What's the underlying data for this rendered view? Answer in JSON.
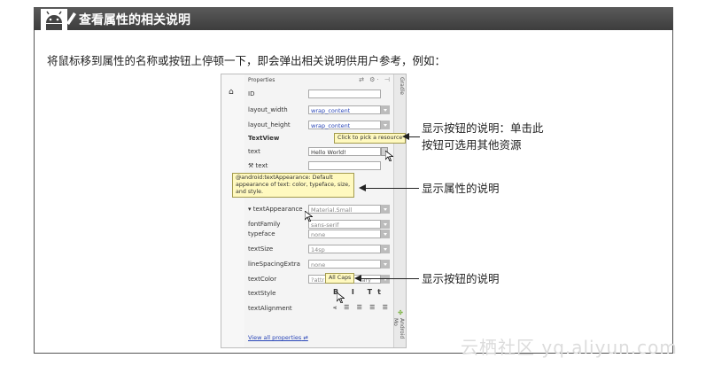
{
  "header": {
    "title": "查看属性的相关说明"
  },
  "intro": "将鼠标移到属性的名称或按钮上停顿一下，即会弹出相关说明供用户参考，例如：",
  "panel": {
    "title": "Properties",
    "side_label_top": "Gradle",
    "side_label_bottom": "Android Mo",
    "rows": [
      {
        "name": "ID",
        "value": ""
      },
      {
        "name": "layout_width",
        "value": "wrap_content"
      },
      {
        "name": "layout_height",
        "value": "wrap_content"
      },
      {
        "name": "TextView",
        "value": ""
      },
      {
        "name": "text",
        "value": "Hello World!"
      },
      {
        "name": "text",
        "value": ""
      },
      {
        "name": "textAppearance",
        "value": "Material.Small"
      },
      {
        "name": "fontFamily",
        "value": "sans-serif"
      },
      {
        "name": "typeface",
        "value": "none"
      },
      {
        "name": "textSize",
        "value": "14sp"
      },
      {
        "name": "lineSpacingExtra",
        "value": "none"
      },
      {
        "name": "textColor",
        "value": "?attr"
      },
      {
        "name": "textStyle",
        "value": ""
      },
      {
        "name": "textAlignment",
        "value": ""
      }
    ],
    "textcolor_suffix": "ary",
    "view_all": "View all properties",
    "style_buttons": "B I Tt",
    "align_buttons": "⫷ ☰ ☰ ☰ ☰"
  },
  "tooltips": {
    "resource": "Click to pick a resource",
    "appearance": "@android:textAppearance: Default appearance of text: color, typeface, size, and style.",
    "allcaps": "All Caps"
  },
  "annotations": {
    "button_line1": "显示按钮的说明：单击此",
    "button_line2": "按钮可选用其他资源",
    "attr": "显示属性的说明",
    "button2": "显示按钮的说明"
  },
  "watermark": "云栖社区 yq.aliyun.com"
}
